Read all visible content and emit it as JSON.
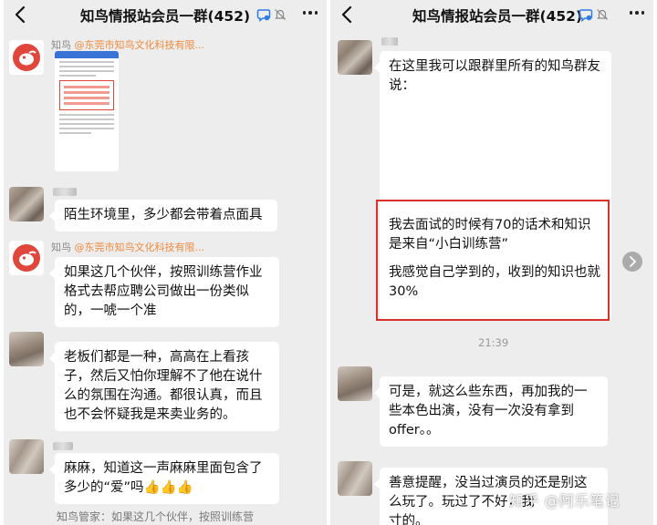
{
  "left": {
    "title": "知鸟情报站会员一群(452)",
    "messages": [
      {
        "name": "知鸟",
        "org": "@东莞市知鸟文化科技有限..."
      },
      {
        "text": "陌生环境里，多少都会带着点面具"
      },
      {
        "name": "知鸟",
        "org": "@东莞市知鸟文化科技有限..."
      },
      {
        "text": "如果这几个伙伴，按照训练营作业格式去帮应聘公司做出一份类似的，一唬一个准"
      },
      {
        "text": "老板们都是一种，高高在上看孩子，然后又怕你理解不了他在说什么的氛围在沟通。都很认真，而且也不会怀疑我是来卖业务的。"
      },
      {
        "text": "麻麻，知道这一声麻麻里面包含了多少的“爱”吗👍👍👍"
      },
      {
        "text": "知鸟管家：如果这几个伙伴，按照训练营"
      }
    ]
  },
  "right": {
    "title": "知鸟情报站会员一群(452)",
    "messages": [
      {
        "text": "在这里我可以跟群里所有的知鸟群友说："
      },
      {
        "text": "我去面试的时候有70的话术和知识是来自“小白训练营”"
      },
      {
        "text": "我感觉自己学到的，收到的知识也就30%"
      },
      {
        "time": "21:39"
      },
      {
        "text": "可是，就这么些东西，再加我的一些本色出演，没有一次没有拿到offer。。"
      },
      {
        "text": "善意提醒，没当过演员的还是别这么玩了。玩过了不好，我"
      },
      {
        "text": "寸的。"
      }
    ],
    "watermark": "知乎 @阿乐笔记"
  }
}
